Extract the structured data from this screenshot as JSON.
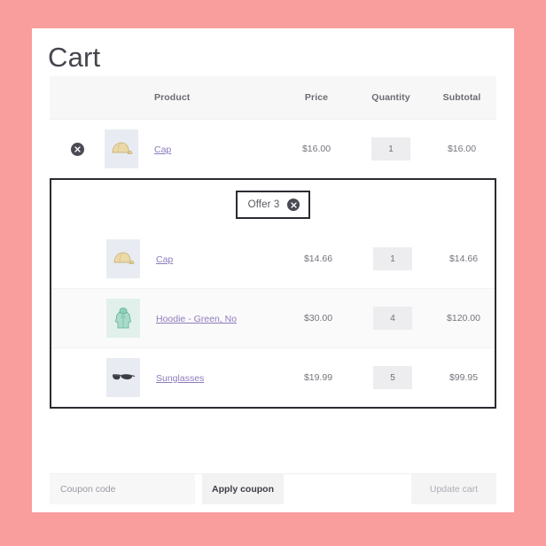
{
  "theme": {
    "page_background": "#fa9d9d",
    "card_background": "#ffffff",
    "link_color": "#8f7bbd",
    "bundle_border_color": "#2b2b33",
    "header_row_background": "#f7f7f8"
  },
  "page": {
    "title": "Cart"
  },
  "table": {
    "headers": {
      "product": "Product",
      "price": "Price",
      "quantity": "Quantity",
      "subtotal": "Subtotal"
    }
  },
  "main_item": {
    "remove_icon": "remove-x-icon",
    "thumb_icon": "cap-thumbnail",
    "name": "Cap",
    "price": "$16.00",
    "quantity": "1",
    "subtotal": "$16.00"
  },
  "bundle": {
    "badge": {
      "label": "Offer 3",
      "remove_icon": "remove-x-icon"
    },
    "items": [
      {
        "thumb_icon": "cap-thumbnail",
        "name": "Cap",
        "price": "$14.66",
        "quantity": "1",
        "subtotal": "$14.66"
      },
      {
        "thumb_icon": "hoodie-thumbnail",
        "name": "Hoodie - Green, No",
        "price": "$30.00",
        "quantity": "4",
        "subtotal": "$120.00"
      },
      {
        "thumb_icon": "sunglasses-thumbnail",
        "name": "Sunglasses",
        "price": "$19.99",
        "quantity": "5",
        "subtotal": "$99.95"
      }
    ]
  },
  "footer": {
    "coupon_placeholder": "Coupon code",
    "coupon_value": "",
    "apply_label": "Apply coupon",
    "update_label": "Update cart"
  }
}
